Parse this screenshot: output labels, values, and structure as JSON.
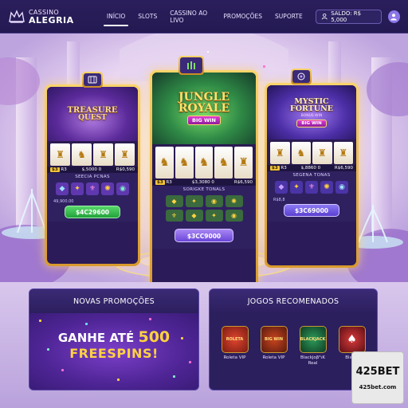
{
  "brand": {
    "line1": "CASSINO",
    "line2": "ALEGRIA"
  },
  "nav": {
    "items": [
      "INÍCIO",
      "SLOTS",
      "CASSINO AO LIVO",
      "PROMOÇÕES",
      "SUPORTE"
    ],
    "active_index": 0
  },
  "balance": {
    "label": "SALDO: R$ 5,000",
    "icon": "user-icon"
  },
  "slots": [
    {
      "title_line1": "TREASURE",
      "title_line2": "QUEST",
      "badge_icon": "slot-machine-icon",
      "reels": [
        "♜",
        "♞",
        "♜",
        "♜"
      ],
      "meter_tag": "$3",
      "meter_left": "R3",
      "meter_mid": "$,5000 0",
      "meter_right": "R$0,590",
      "sub_label": "SEECIA PCNAS",
      "mini_icons": [
        "◆",
        "✦",
        "⚜",
        "✺",
        "◉"
      ],
      "sub_note": "49,900.00",
      "button": "$4C29600",
      "accent": "#7a3fb8"
    },
    {
      "title_line1": "JUNGLE",
      "title_line2": "ROYALE",
      "tag": "BIG WIN",
      "badge_icon": "leaf-icon",
      "reels": [
        "♞",
        "♞",
        "♞",
        "♞",
        "♜"
      ],
      "meter_tag": "$3",
      "meter_left": "R3",
      "meter_mid": "$3,3080 0",
      "meter_right": "R$6,590",
      "sub_label": "SORIGKE TONALS",
      "mini_icons": [
        "◆",
        "✦",
        "◉",
        "✺",
        "⚜",
        "◆",
        "✦",
        "◉"
      ],
      "button": "$3CC9000",
      "accent": "#2f8a46"
    },
    {
      "title_line1": "MYSTIC",
      "title_line2": "FORTUNE",
      "subtitle": "BONUS WIN",
      "tag": "BIG WIN",
      "badge_icon": "mystic-eye-icon",
      "reels": [
        "♜",
        "♞",
        "♜",
        "♜"
      ],
      "meter_tag": "$3",
      "meter_left": "R3",
      "meter_mid": "$,8860 0",
      "meter_right": "R$6,590",
      "sub_label": "SEGENA TONAS",
      "mini_icons": [
        "◆",
        "✦",
        "⚜",
        "✺",
        "◉"
      ],
      "sub_note": "R$8,8",
      "button": "$3C69000",
      "accent": "#4d2fa8"
    }
  ],
  "promos": {
    "title": "NOVAS PROMOÇÕES",
    "line1_prefix": "GANHE ATÉ",
    "line1_number": "500",
    "line2": "FREESPINS!"
  },
  "recommended": {
    "title": "JOGOS RECOMENADOS",
    "games": [
      {
        "thumb": "ROLETA",
        "label1": "Roleta VIP",
        "label2": ""
      },
      {
        "thumb": "BIG WIN",
        "label1": "Roleta VIP",
        "label2": ""
      },
      {
        "thumb": "BLACKJACK",
        "label1": "Blackjoβ³ιK",
        "label2": "Real"
      },
      {
        "thumb": "♠",
        "label1": "Blackj",
        "label2": ""
      }
    ]
  },
  "watermark": {
    "line1": "425BET",
    "line2": "425bet.com"
  }
}
